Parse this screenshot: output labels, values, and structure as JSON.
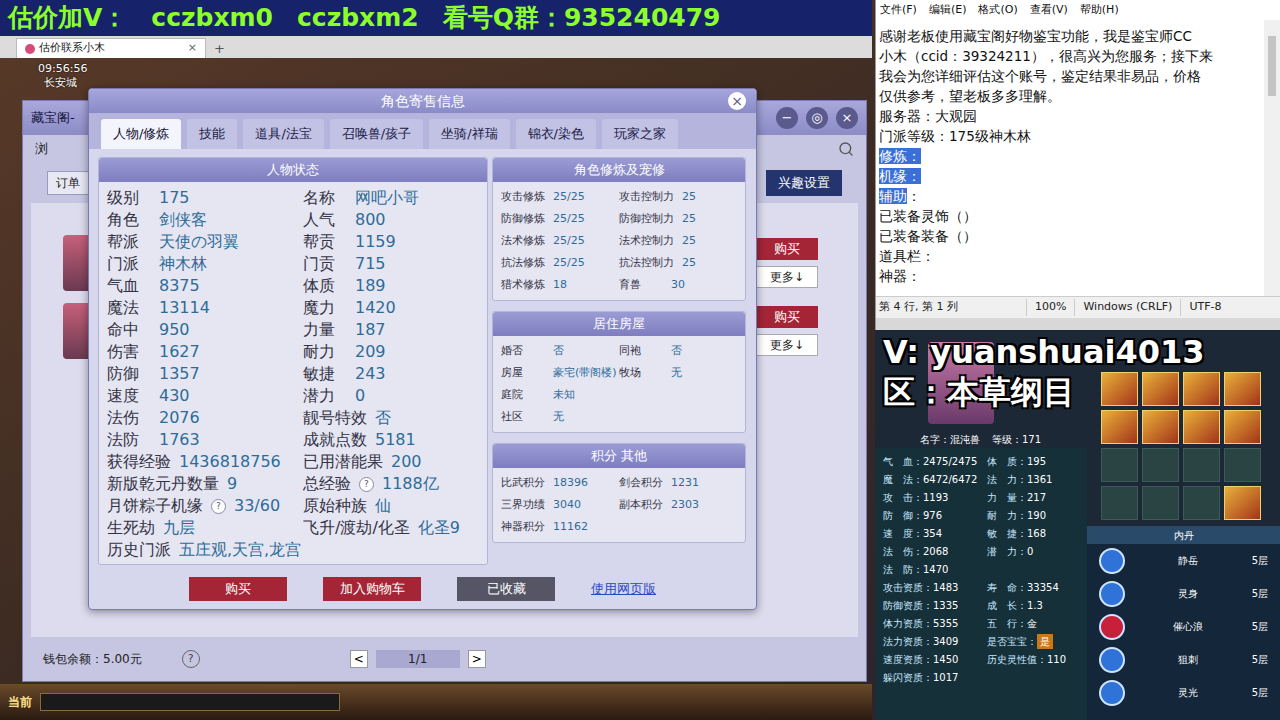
{
  "banner": {
    "segments": [
      "估价加V：",
      "cczbxm0",
      "cczbxm2",
      "看号Q群：935240479"
    ]
  },
  "browser": {
    "tab_title": "估价联系小木",
    "tab_close": "×",
    "new_tab": "+"
  },
  "game": {
    "time": "09:56:56",
    "location": "长安城",
    "window_title": "藏宝阁-",
    "window_controls": [
      "−",
      "◎",
      "×"
    ],
    "nav_partial": "浏",
    "order_button": "订单",
    "interest_button": "兴趣设置",
    "listings": [
      {
        "buy": "购买",
        "more": "更多↓"
      },
      {
        "buy": "购买",
        "more": "更多↓"
      }
    ],
    "wallet": "钱包余额：5.00元",
    "help": "?",
    "pager": {
      "prev": "<",
      "page": "1/1",
      "next": ">"
    },
    "toolbar_label": "当前"
  },
  "dialog": {
    "title": "角色寄售信息",
    "close": "×",
    "tabs": [
      {
        "label": "人物/修炼",
        "selected": true
      },
      {
        "label": "技能",
        "selected": false
      },
      {
        "label": "道具/法宝",
        "selected": false
      },
      {
        "label": "召唤兽/孩子",
        "selected": false
      },
      {
        "label": "坐骑/祥瑞",
        "selected": false
      },
      {
        "label": "锦衣/染色",
        "selected": false
      },
      {
        "label": "玩家之家",
        "selected": false
      }
    ],
    "status": {
      "title": "人物状态",
      "rows": [
        [
          {
            "label": "级别",
            "value": "175"
          },
          {
            "label": "名称",
            "value": "网吧小哥"
          }
        ],
        [
          {
            "label": "角色",
            "value": "剑侠客"
          },
          {
            "label": "人气",
            "value": "800"
          }
        ],
        [
          {
            "label": "帮派",
            "value": "天使の羽翼"
          },
          {
            "label": "帮贡",
            "value": "1159"
          }
        ],
        [
          {
            "label": "门派",
            "value": "神木林"
          },
          {
            "label": "门贡",
            "value": "715"
          }
        ],
        [
          {
            "label": "气血",
            "value": "8375"
          },
          {
            "label": "体质",
            "value": "189"
          }
        ],
        [
          {
            "label": "魔法",
            "value": "13114"
          },
          {
            "label": "魔力",
            "value": "1420"
          }
        ],
        [
          {
            "label": "命中",
            "value": "950"
          },
          {
            "label": "力量",
            "value": "187"
          }
        ],
        [
          {
            "label": "伤害",
            "value": "1627"
          },
          {
            "label": "耐力",
            "value": "209"
          }
        ],
        [
          {
            "label": "防御",
            "value": "1357"
          },
          {
            "label": "敏捷",
            "value": "243"
          }
        ],
        [
          {
            "label": "速度",
            "value": "430"
          },
          {
            "label": "潜力",
            "value": "0"
          }
        ],
        [
          {
            "label": "法伤",
            "value": "2076"
          },
          {
            "label": "靓号特效",
            "value": "否"
          }
        ],
        [
          {
            "label": "法防",
            "value": "1763"
          },
          {
            "label": "成就点数",
            "value": "5181"
          }
        ],
        [
          {
            "label": "获得经验",
            "value": "1436818756"
          },
          {
            "label": "已用潜能果",
            "value": "200"
          }
        ],
        [
          {
            "label": "新版乾元丹数量",
            "value": "9"
          },
          {
            "label": "总经验",
            "value": "1188亿",
            "help": "?"
          }
        ],
        [
          {
            "label": "月饼粽子机缘",
            "value": "33/60",
            "help": "?"
          },
          {
            "label": "原始种族",
            "value": "仙"
          }
        ],
        [
          {
            "label": "生死劫",
            "value": "九层"
          },
          {
            "label": "飞升/渡劫/化圣",
            "value": "化圣9"
          }
        ],
        [
          {
            "label": "历史门派",
            "value": "五庄观,天宫,龙宫"
          }
        ]
      ]
    },
    "cultivation": {
      "title": "角色修炼及宠修",
      "rows": [
        [
          {
            "label": "攻击修炼",
            "value": "25/25"
          },
          {
            "label": "攻击控制力",
            "value": "25"
          }
        ],
        [
          {
            "label": "防御修炼",
            "value": "25/25"
          },
          {
            "label": "防御控制力",
            "value": "25"
          }
        ],
        [
          {
            "label": "法术修炼",
            "value": "25/25"
          },
          {
            "label": "法术控制力",
            "value": "25"
          }
        ],
        [
          {
            "label": "抗法修炼",
            "value": "25/25"
          },
          {
            "label": "抗法控制力",
            "value": "25"
          }
        ],
        [
          {
            "label": "猎术修炼",
            "value": "18"
          },
          {
            "label": "育兽",
            "value": "30"
          }
        ]
      ]
    },
    "house": {
      "title": "居住房屋",
      "rows": [
        [
          {
            "label": "婚否",
            "value": "否"
          },
          {
            "label": "同袍",
            "value": "否"
          }
        ],
        [
          {
            "label": "房屋",
            "value": "豪宅(带阁楼)"
          },
          {
            "label": "牧场",
            "value": "无"
          }
        ],
        [
          {
            "label": "庭院",
            "value": "未知"
          }
        ],
        [
          {
            "label": "社区",
            "value": "无"
          }
        ]
      ]
    },
    "points": {
      "title": "积分 其他",
      "rows": [
        [
          {
            "label": "比武积分",
            "value": "18396"
          },
          {
            "label": "剑会积分",
            "value": "1231"
          }
        ],
        [
          {
            "label": "三界功绩",
            "value": "3040"
          },
          {
            "label": "副本积分",
            "value": "2303"
          }
        ],
        [
          {
            "label": "神器积分",
            "value": "11162"
          }
        ]
      ]
    },
    "buttons": [
      {
        "label": "购买",
        "kind": "primary"
      },
      {
        "label": "加入购物车",
        "kind": "primary"
      },
      {
        "label": "已收藏",
        "kind": "muted"
      },
      {
        "label": "使用网页版",
        "kind": "link"
      }
    ]
  },
  "notepad": {
    "menu": [
      "文件(F)",
      "编辑(E)",
      "格式(O)",
      "查看(V)",
      "帮助(H)"
    ],
    "lines": [
      [
        {
          "text": "感谢老板使用藏宝阁好物鉴宝功能，我是鉴宝师CC",
          "highlighted": false
        }
      ],
      [
        {
          "text": "小木（ccid：39324211），很高兴为您服务；接下来",
          "highlighted": false
        }
      ],
      [
        {
          "text": "我会为您详细评估这个账号，鉴定结果非易品，价格",
          "highlighted": false
        }
      ],
      [
        {
          "text": "仅供参考，望老板多多理解。",
          "highlighted": false
        }
      ],
      [
        {
          "text": "服务器：大观园",
          "highlighted": false
        }
      ],
      [
        {
          "text": "门派等级：175级神木林",
          "highlighted": false
        }
      ],
      [
        {
          "text": "修炼：",
          "highlighted": true
        }
      ],
      [
        {
          "text": "机缘：",
          "highlighted": true
        }
      ],
      [
        {
          "text": "辅助",
          "highlighted": true
        },
        {
          "text": "：",
          "highlighted": false
        }
      ],
      [
        {
          "text": "已装备灵饰（）",
          "highlighted": false
        }
      ],
      [
        {
          "text": "已装备装备（）",
          "highlighted": false
        }
      ],
      [
        {
          "text": "道具栏：",
          "highlighted": false
        }
      ],
      [
        {
          "text": "神器：",
          "highlighted": false
        }
      ]
    ],
    "status": [
      "第 4 行, 第 1 列",
      "100%",
      "Windows (CRLF)",
      "UTF-8"
    ]
  },
  "overlay": {
    "contact": "V: yuanshuai4013",
    "region": "区：本草纲目",
    "pet": {
      "name": "名字：混沌兽",
      "level": "等级：171",
      "stats": [
        [
          {
            "label": "气　血：",
            "value": "2475/2475"
          },
          {
            "label": "体　质：",
            "value": "195"
          }
        ],
        [
          {
            "label": "魔　法：",
            "value": "6472/6472"
          },
          {
            "label": "法　力：",
            "value": "1361"
          }
        ],
        [
          {
            "label": "攻　击：",
            "value": "1193"
          },
          {
            "label": "力　量：",
            "value": "217"
          }
        ],
        [
          {
            "label": "防　御：",
            "value": "976"
          },
          {
            "label": "耐　力：",
            "value": "190"
          }
        ],
        [
          {
            "label": "速　度：",
            "value": "354"
          },
          {
            "label": "敏　捷：",
            "value": "168"
          }
        ],
        [
          {
            "label": "法　伤：",
            "value": "2068"
          },
          {
            "label": "潜　力：",
            "value": "0"
          }
        ],
        [
          {
            "label": "法　防：",
            "value": "1470"
          }
        ],
        [
          {
            "label": "攻击资质：",
            "value": "1483"
          },
          {
            "label": "寿　命：",
            "value": "33354"
          }
        ],
        [
          {
            "label": "防御资质：",
            "value": "1335"
          },
          {
            "label": "成　长：",
            "value": "1.3"
          }
        ],
        [
          {
            "label": "体力资质：",
            "value": "5355"
          },
          {
            "label": "五　行：",
            "value": "金"
          }
        ],
        [
          {
            "label": "法力资质：",
            "value": "3409"
          },
          {
            "label": "是否宝宝：",
            "value": "是",
            "badge": true
          }
        ],
        [
          {
            "label": "速度资质：",
            "value": "1450"
          },
          {
            "label": "历史灵性值：",
            "value": "110"
          }
        ],
        [
          {
            "label": "躲闪资质：",
            "value": "1017"
          }
        ]
      ],
      "skills": [
        true,
        true,
        true,
        true,
        true,
        true,
        true,
        true,
        false,
        false,
        false,
        false,
        false,
        false,
        false,
        true
      ],
      "neidan_title": "内丹",
      "neidan": [
        {
          "name": "静岳",
          "level": "5层",
          "color": "#2f73d8"
        },
        {
          "name": "灵身",
          "level": "5层",
          "color": "#2f73d8"
        },
        {
          "name": "催心浪",
          "level": "5层",
          "color": "#c8203a"
        },
        {
          "name": "狙刺",
          "level": "5层",
          "color": "#2f73d8"
        },
        {
          "name": "灵光",
          "level": "5层",
          "color": "#2f73d8"
        }
      ]
    }
  }
}
